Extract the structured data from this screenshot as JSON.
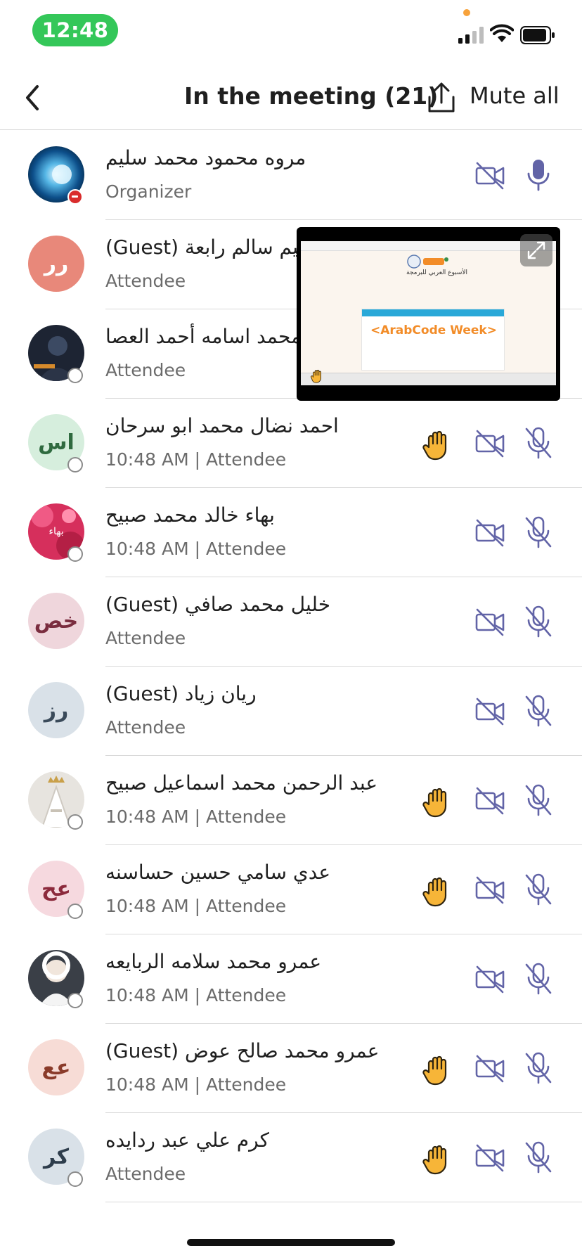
{
  "status_bar": {
    "time": "12:48",
    "colors": {
      "time_pill": "#34c759",
      "privacy_dot": "#f7a23b"
    }
  },
  "header": {
    "title": "In the meeting (21)",
    "mute_all_label": "Mute all",
    "icons": {
      "back": "chevron-left-icon",
      "share": "share-icon"
    }
  },
  "colors": {
    "accent": "#6264a7",
    "raised_hand": "#f7b538",
    "divider": "#d9d9d9",
    "secondary_text": "#6b6b6b"
  },
  "participants": [
    {
      "name": "مروه محمود محمد سليم",
      "role": "Organizer",
      "avatar": "",
      "avatar_kind": "image-blue",
      "presence": "do-not-disturb",
      "hand_raised": false,
      "video": "off",
      "mic": "on"
    },
    {
      "name": "(Guest) ابراهيم سالم رابعة",
      "role": "Attendee",
      "avatar": "رر",
      "avatar_kind": "initials",
      "avatar_bg": "#e8887a",
      "avatar_fg": "#ffffff",
      "presence": "none",
      "hand_raised": false,
      "video": "off",
      "mic": "off"
    },
    {
      "name": "محمد اسامه أحمد العصا",
      "role": "Attendee",
      "avatar": "",
      "avatar_kind": "image-dark",
      "presence": "offline",
      "hand_raised": false,
      "video": "off",
      "mic": "off"
    },
    {
      "name": "احمد نضال محمد ابو سرحان",
      "role": "10:48 AM | Attendee",
      "avatar": "اس",
      "avatar_kind": "initials",
      "avatar_bg": "#d6eedd",
      "avatar_fg": "#2f6a3f",
      "presence": "offline",
      "hand_raised": true,
      "video": "off",
      "mic": "off"
    },
    {
      "name": "بهاء خالد محمد صبيح",
      "role": "10:48 AM | Attendee",
      "avatar": "بهاء",
      "avatar_kind": "image-pink",
      "presence": "offline",
      "hand_raised": false,
      "video": "off",
      "mic": "off"
    },
    {
      "name": "(Guest)  خليل محمد صافي",
      "role": "Attendee",
      "avatar": "خص",
      "avatar_kind": "initials",
      "avatar_bg": "#efd6dc",
      "avatar_fg": "#7a2d3f",
      "presence": "none",
      "hand_raised": false,
      "video": "off",
      "mic": "off"
    },
    {
      "name": "(Guest) ريان زياد",
      "role": "Attendee",
      "avatar": "رز",
      "avatar_kind": "initials",
      "avatar_bg": "#d9e1e8",
      "avatar_fg": "#3a4a5a",
      "presence": "none",
      "hand_raised": false,
      "video": "off",
      "mic": "off"
    },
    {
      "name": "عبد الرحمن محمد اسماعيل صبيح",
      "role": "10:48 AM | Attendee",
      "avatar": "",
      "avatar_kind": "image-crown",
      "presence": "offline",
      "hand_raised": true,
      "video": "off",
      "mic": "off"
    },
    {
      "name": "عدي سامي حسين حساسنه",
      "role": "10:48 AM | Attendee",
      "avatar": "عح",
      "avatar_kind": "initials",
      "avatar_bg": "#f6d9df",
      "avatar_fg": "#8c2a3c",
      "presence": "offline",
      "hand_raised": true,
      "video": "off",
      "mic": "off"
    },
    {
      "name": "عمرو محمد سلامه الربايعه",
      "role": "10:48 AM | Attendee",
      "avatar": "",
      "avatar_kind": "image-baby",
      "presence": "offline",
      "hand_raised": false,
      "video": "off",
      "mic": "off"
    },
    {
      "name": "(Guest) عمرو محمد صالح عوض",
      "role": "10:48 AM | Attendee",
      "avatar": "عع",
      "avatar_kind": "initials",
      "avatar_bg": "#f7dcd6",
      "avatar_fg": "#8a3b2a",
      "presence": "none",
      "hand_raised": true,
      "video": "off",
      "mic": "off"
    },
    {
      "name": "كرم علي عبد ردايده",
      "role": "Attendee",
      "avatar": "كر",
      "avatar_kind": "initials",
      "avatar_bg": "#d9e1e8",
      "avatar_fg": "#2e3d4c",
      "presence": "offline",
      "hand_raised": true,
      "video": "off",
      "mic": "off"
    }
  ],
  "shared_screen": {
    "header_text": "الأسبوع العربي للبرمجة",
    "logo_text": "<ArabCode Week>",
    "icons": {
      "expand": "expand-icon"
    }
  }
}
